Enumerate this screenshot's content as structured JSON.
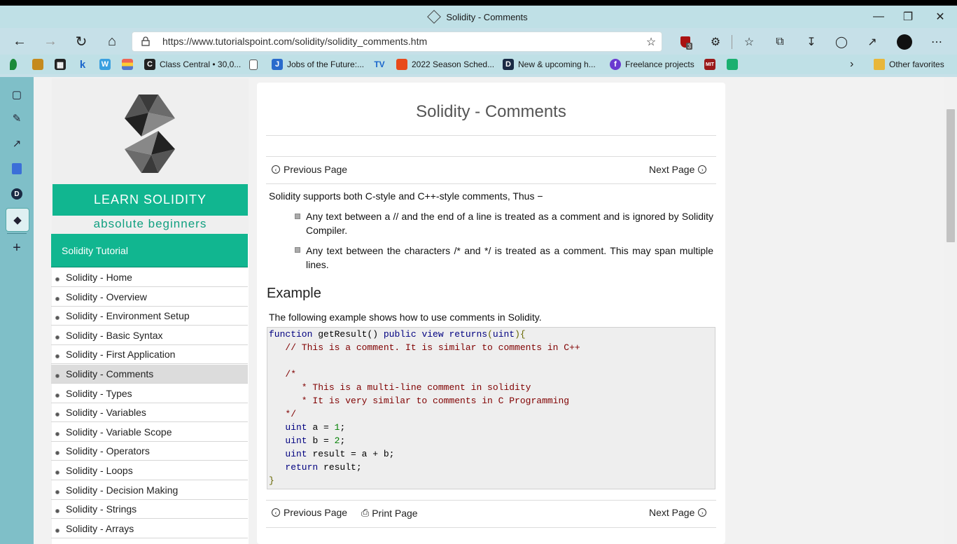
{
  "window": {
    "title": "Solidity - Comments"
  },
  "address_bar": {
    "url": "https://www.tutorialspoint.com/solidity/solidity_comments.htm",
    "extension_badge": "3"
  },
  "favorites": {
    "items": [
      {
        "label": "Class Central • 30,0...",
        "icon": "class-central-icon"
      },
      {
        "label": "Jobs of the Future:...",
        "icon": "jobs-icon"
      },
      {
        "label": "2022 Season Sched...",
        "icon": "schedule-icon"
      },
      {
        "label": "New & upcoming h...",
        "icon": "devpost-icon"
      },
      {
        "label": "Freelance projects",
        "icon": "freelance-icon"
      }
    ],
    "other_favorites": "Other favorites"
  },
  "left_nav": {
    "banner_title": "LEARN SOLIDITY",
    "banner_subtitle": "absolute beginners",
    "heading": "Solidity Tutorial",
    "items": [
      "Solidity - Home",
      "Solidity - Overview",
      "Solidity - Environment Setup",
      "Solidity - Basic Syntax",
      "Solidity - First Application",
      "Solidity - Comments",
      "Solidity - Types",
      "Solidity - Variables",
      "Solidity - Variable Scope",
      "Solidity - Operators",
      "Solidity - Loops",
      "Solidity - Decision Making",
      "Solidity - Strings",
      "Solidity - Arrays"
    ],
    "active_item": "Solidity - Comments"
  },
  "content": {
    "title": "Solidity - Comments",
    "prev": "Previous Page",
    "next": "Next Page",
    "print": "Print Page",
    "intro": "Solidity supports both C-style and C++-style comments, Thus −",
    "bullets": [
      "Any text between a // and the end of a line is treated as a comment and is ignored by Solidity Compiler.",
      "Any text between the characters /* and */ is treated as a comment. This may span multiple lines."
    ],
    "example_heading": "Example",
    "example_intro": "The following example shows how to use comments in Solidity.",
    "code": {
      "l1_kw": "function",
      "l1_rest": " getResult() ",
      "l1_kw2": "public view returns",
      "l1_tail": "(",
      "l1_type": "uint",
      "l1_end": "){",
      "l2": "   // This is a comment. It is similar to comments in C++",
      "l4": "   /*",
      "l5": "      * This is a multi-line comment in solidity",
      "l6": "      * It is very similar to comments in C Programming",
      "l7": "   */",
      "l8_a": "a",
      "l8_v": "1",
      "l9_b": "b",
      "l9_v": "2",
      "l10": "result",
      "l10_rest": " = a + b;",
      "l11_kw": "return",
      "l11_rest": " result;",
      "l12": "}",
      "uint": "uint"
    }
  },
  "colors": {
    "accent": "#11b690",
    "chrome": "#bfe0e6",
    "sidebar": "#7fbfc8"
  }
}
